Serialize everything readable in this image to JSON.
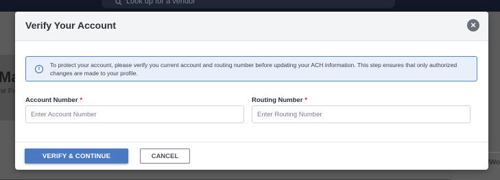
{
  "background": {
    "search_placeholder": "Look up for a vendor",
    "page_title_fragment": "Mat",
    "page_subtitle_fragment": "ne Fis",
    "right_text_fragment": "/Wo"
  },
  "modal": {
    "title": "Verify Your Account",
    "close_icon": "close-circle-icon",
    "info": {
      "icon": "info-icon",
      "text": "To protect your account, please verify you current account and routing number before updating your ACH information. This step ensures that only authorized changes are made to your profile."
    },
    "fields": {
      "account_number": {
        "label": "Account Number",
        "required_mark": "*",
        "placeholder": "Enter Account Number",
        "value": ""
      },
      "routing_number": {
        "label": "Routing Number",
        "required_mark": "*",
        "placeholder": "Enter Routing Number",
        "value": ""
      }
    },
    "buttons": {
      "verify": "VERIFY & CONTINUE",
      "cancel": "CANCEL"
    }
  },
  "colors": {
    "primary": "#4a78c2",
    "info_border": "#5a84c9",
    "info_bg": "#e8f0fb",
    "required": "#d9262c"
  }
}
